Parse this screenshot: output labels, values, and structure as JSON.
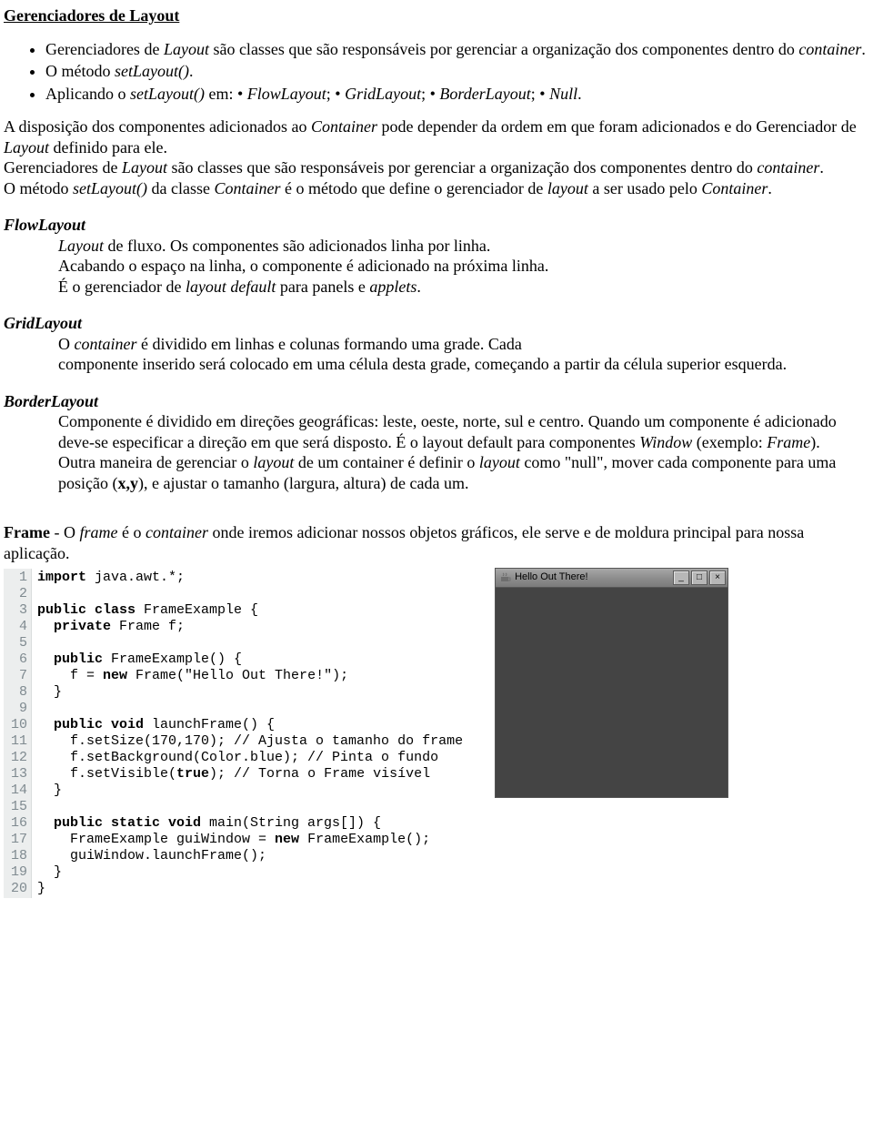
{
  "title": "Gerenciadores de Layout",
  "bullets": {
    "b1a": "Gerenciadores de ",
    "b1b": "Layout",
    "b1c": " são classes que são responsáveis por gerenciar a organização dos componentes dentro do ",
    "b1d": "container",
    "b1e": ".",
    "b2a": "O método ",
    "b2b": "setLayout()",
    "b2c": ".",
    "b3a": "Aplicando o ",
    "b3b": "setLayout()",
    "b3c": " em: • ",
    "b3d": "FlowLayout",
    "b3e": "; • ",
    "b3f": "GridLayout",
    "b3g": "; • ",
    "b3h": "BorderLayout",
    "b3i": "; • ",
    "b3j": "Null",
    "b3k": "."
  },
  "para1": {
    "a": "A disposição dos componentes adicionados ao ",
    "cont": "Container",
    "b": " pode depender da ordem em que foram adicionados e do Gerenciador de ",
    "lay": "Layout",
    "c": " definido para ele."
  },
  "para2": {
    "a": "Gerenciadores de ",
    "lay": "Layout",
    "b": " são classes que são responsáveis por gerenciar a organização dos componentes dentro do ",
    "cont": "container",
    "c": "."
  },
  "para3": {
    "a": "O método ",
    "m": "setLayout()",
    "b": " da classe ",
    "cont": "Container",
    "c": " é o método que define o gerenciador de ",
    "lay": "layout",
    "d": " a ser usado pelo ",
    "cont2": "Container",
    "e": "."
  },
  "flow": {
    "title": "FlowLayout",
    "l1a": "Layout",
    "l1b": " de fluxo. Os componentes são adicionados linha por linha.",
    "l2": "Acabando o espaço na linha, o componente é adicionado na próxima linha.",
    "l3a": "É o gerenciador de ",
    "l3b": "layout default",
    "l3c": " para panels e ",
    "l3d": "applets",
    "l3e": "."
  },
  "grid": {
    "title": "GridLayout",
    "l1a": "O ",
    "l1b": "container",
    "l1c": " é dividido em linhas e colunas formando uma grade. Cada",
    "l2": "componente inserido será colocado em uma célula desta grade, começando a partir da célula superior esquerda."
  },
  "border": {
    "title": "BorderLayout",
    "l1": "Componente é dividido em direções geográficas: leste, oeste, norte, sul e centro. Quando um componente é adicionado deve-se especificar a direção em que será disposto. É o layout default para componentes ",
    "l1w": "Window",
    "l1b": " (exemplo: ",
    "l1f": "Frame",
    "l1c": ").",
    "l2a": "Outra maneira de gerenciar o ",
    "l2b": "layout",
    "l2c": " de um container é definir o ",
    "l2d": "layout",
    "l2e": " como \"null\", mover cada componente para uma posição (",
    "l2f": "x,y",
    "l2g": "), e ajustar o tamanho (largura, altura) de cada um."
  },
  "frame": {
    "strong": "Frame",
    "dash": "  -",
    "a": " O ",
    "f": "frame",
    "b": " é o ",
    "c": "container",
    "d": " onde iremos adicionar nossos objetos gráficos, ele serve e de moldura principal para nossa aplicação."
  },
  "code": {
    "gutter": " 1\n 2\n 3\n 4\n 5\n 6\n 7\n 8\n 9\n10\n11\n12\n13\n14\n15\n16\n17\n18\n19\n20",
    "l1a": "import",
    "l1b": " java.awt.*;",
    "l3a": "public class",
    "l3b": " FrameExample {",
    "l4a": "  private",
    "l4b": " Frame f;",
    "l6a": "  public",
    "l6b": " FrameExample() {",
    "l7a": "    f = ",
    "l7b": "new",
    "l7c": " Frame(\"Hello Out There!\");",
    "l8": "  }",
    "l10a": "  public void",
    "l10b": " launchFrame() {",
    "l11": "    f.setSize(170,170); // Ajusta o tamanho do frame",
    "l12": "    f.setBackground(Color.blue); // Pinta o fundo",
    "l13a": "    f.setVisible(",
    "l13b": "true",
    "l13c": "); // Torna o Frame visível",
    "l14": "  }",
    "l16a": "  public static void",
    "l16b": " main(String args[]) {",
    "l17a": "    FrameExample guiWindow = ",
    "l17b": "new",
    "l17c": " FrameExample();",
    "l18": "    guiWindow.launchFrame();",
    "l19": "  }",
    "l20": "}"
  },
  "window": {
    "title": "Hello Out There!",
    "min": "_",
    "max": "□",
    "close": "×"
  }
}
